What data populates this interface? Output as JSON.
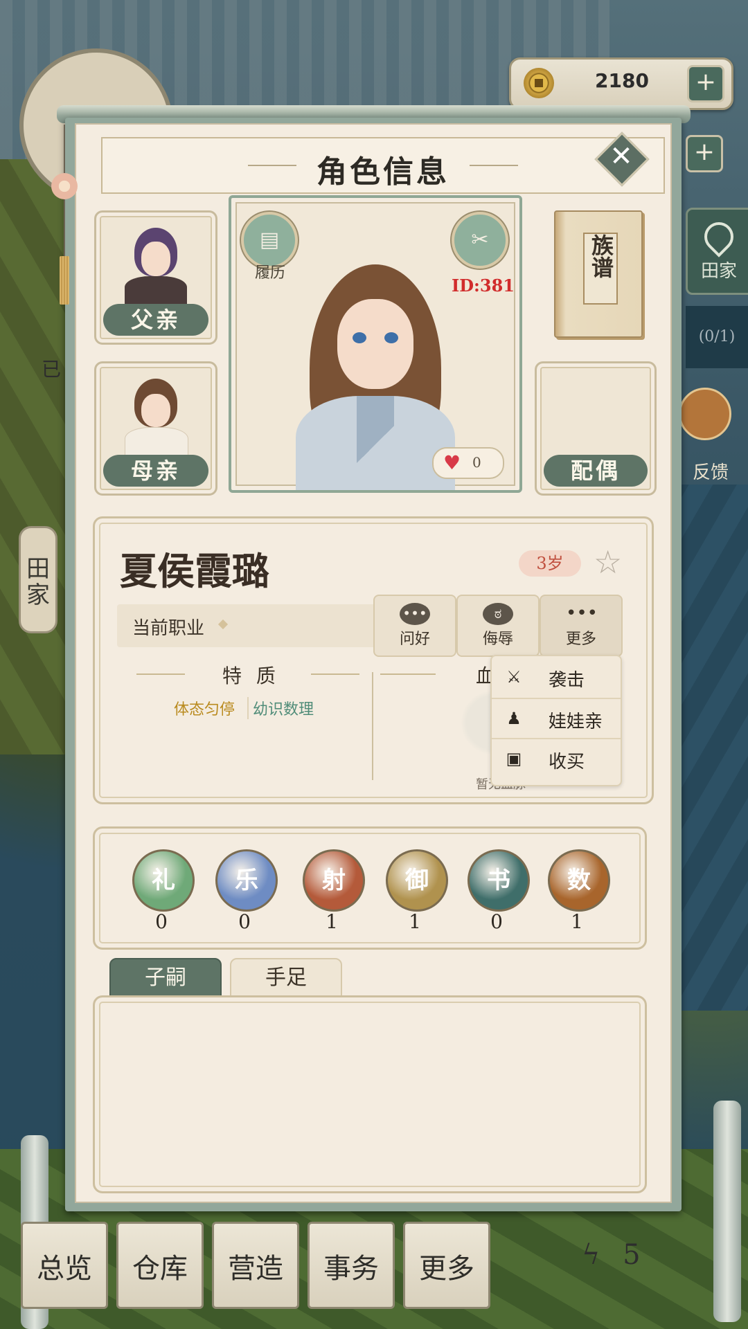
{
  "resources": {
    "coins": "2180"
  },
  "side": {
    "location_label": "田家",
    "count_label": "(0/1)",
    "feedback_label": "反馈"
  },
  "left_tab": {
    "label": "田\n家",
    "small": "已"
  },
  "panel": {
    "title": "角色信息"
  },
  "portrait": {
    "resume_label": "履历",
    "id_text": "ID:381",
    "likes": "0"
  },
  "relatives": {
    "father": "父亲",
    "mother": "母亲",
    "spouse": "配偶"
  },
  "book": {
    "title": "族谱"
  },
  "character": {
    "name": "夏侯霞璐",
    "age": "3岁",
    "job_label": "当前职业",
    "traits_title": "特 质",
    "blood_title": "血",
    "traits": [
      {
        "label": "体态匀停",
        "color": "#b98a1e"
      },
      {
        "label": "幼识数理",
        "color": "#4f8c78"
      }
    ],
    "no_blood_text": "暂无血脉"
  },
  "actions": [
    {
      "label": "问好",
      "icon": "speech-bubble-icon"
    },
    {
      "label": "侮辱",
      "icon": "angry-face-icon"
    },
    {
      "label": "更多",
      "icon": "more-dots-icon"
    }
  ],
  "more_menu": [
    {
      "label": "袭击",
      "icon": "crossed-swords-icon"
    },
    {
      "label": "娃娃亲",
      "icon": "kneel-person-icon"
    },
    {
      "label": "收买",
      "icon": "gift-icon"
    }
  ],
  "skills": [
    {
      "label": "礼",
      "value": "0",
      "color": "#6fa978"
    },
    {
      "label": "乐",
      "value": "0",
      "color": "#6e8cc3"
    },
    {
      "label": "射",
      "value": "1",
      "color": "#b45a3a"
    },
    {
      "label": "御",
      "value": "1",
      "color": "#b0924e"
    },
    {
      "label": "书",
      "value": "0",
      "color": "#3f6e6a"
    },
    {
      "label": "数",
      "value": "1",
      "color": "#a8652c"
    }
  ],
  "tabs": [
    {
      "label": "子嗣",
      "active": true
    },
    {
      "label": "手足",
      "active": false
    }
  ],
  "bottom_nav": [
    {
      "label": "总览"
    },
    {
      "label": "仓库"
    },
    {
      "label": "营造"
    },
    {
      "label": "事务"
    },
    {
      "label": "更多"
    }
  ],
  "energy": {
    "value": "5"
  }
}
